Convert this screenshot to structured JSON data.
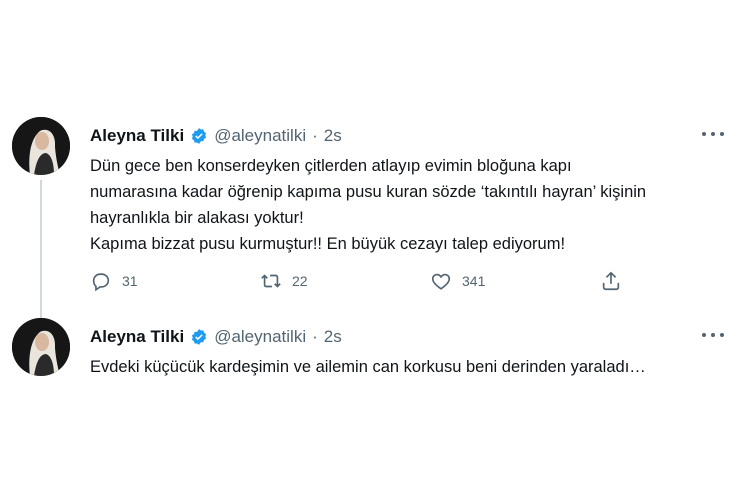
{
  "tweets": [
    {
      "author": "Aleyna Tilki",
      "handle": "@aleynatilki",
      "separator": "·",
      "time": "2s",
      "lines": [
        "Dün gece ben konserdeyken çitlerden atlayıp evimin bloğuna kapı",
        "numarasına kadar öğrenip kapıma pusu kuran sözde ‘takıntılı hayran’ kişinin",
        "hayranlıkla bir alakası yoktur!",
        "Kapıma bizzat pusu kurmuştur!! En büyük cezayı talep ediyorum!"
      ],
      "reply_count": "31",
      "retweet_count": "22",
      "like_count": "341"
    },
    {
      "author": "Aleyna Tilki",
      "handle": "@aleynatilki",
      "separator": "·",
      "time": "2s",
      "lines": [
        "Evdeki küçücük kardeşimin ve ailemin can korkusu beni derinden yaraladı…"
      ]
    }
  ],
  "colors": {
    "text": "#0f1419",
    "secondary": "#536471",
    "verified": "#1d9bf0",
    "thread_line": "#cfd9de"
  },
  "icons": [
    "verified-badge-icon",
    "more-icon",
    "reply-icon",
    "retweet-icon",
    "like-icon",
    "share-icon"
  ]
}
